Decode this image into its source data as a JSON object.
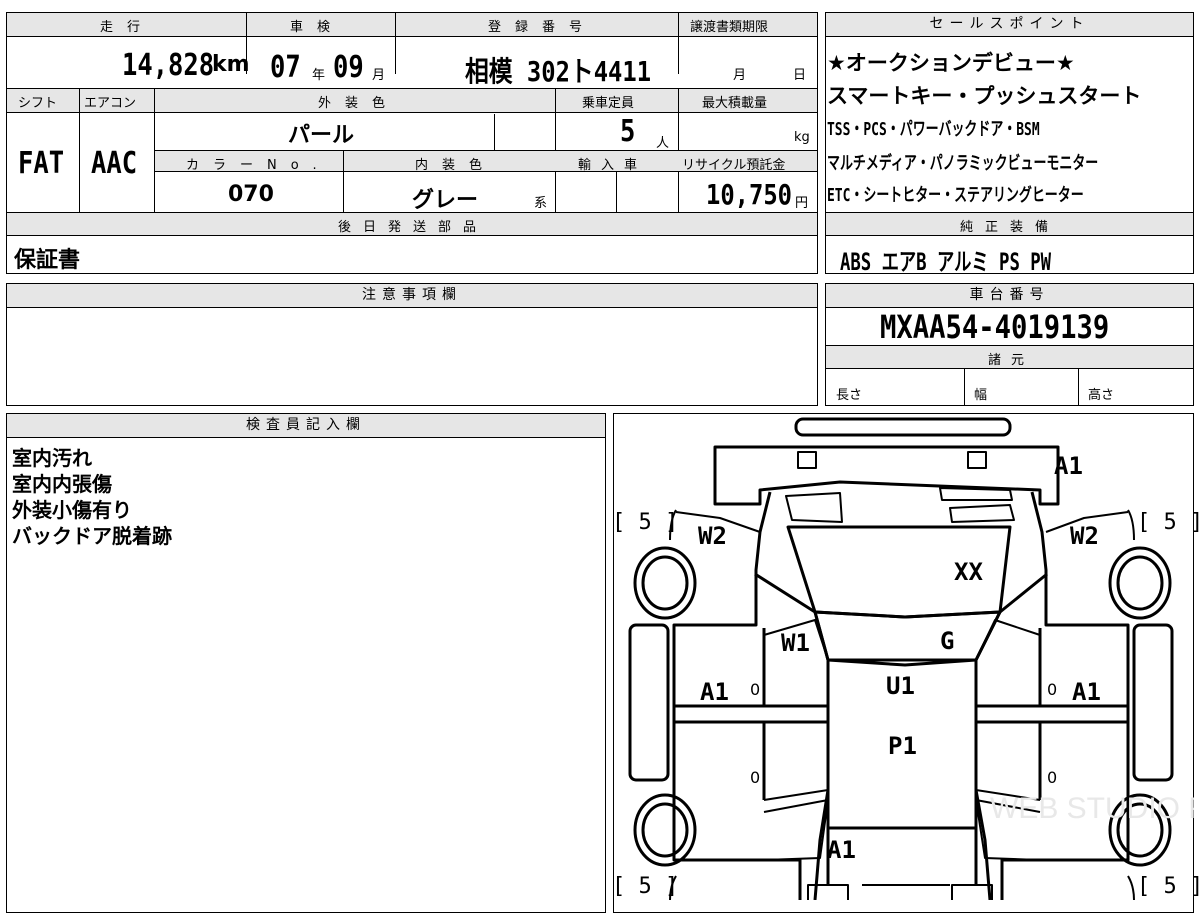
{
  "top_table": {
    "mileage_label": "走行",
    "mileage_value": "14,828",
    "mileage_unit": "km",
    "inspection_label": "車検",
    "inspection_year": "07",
    "inspection_year_unit": "年",
    "inspection_month": "09",
    "inspection_month_unit": "月",
    "plate_label": "登録番号",
    "plate_value": "相模 302ト4411",
    "transfer_label": "譲渡書類期限",
    "transfer_month_unit": "月",
    "transfer_day_unit": "日",
    "shift_label": "シフト",
    "shift_value": "FAT",
    "aircon_label": "エアコン",
    "aircon_value": "AAC",
    "exterior_color_label": "外装色",
    "exterior_color_value": "パール",
    "capacity_label": "乗車定員",
    "capacity_value": "5",
    "capacity_unit": "人",
    "max_load_label": "最大積載量",
    "max_load_unit": "kg",
    "color_no_label": "カラーNo.",
    "color_no_value": "070",
    "interior_color_label": "内装色",
    "interior_color_value": "グレー",
    "interior_color_suffix": "系",
    "import_label": "輸入車",
    "recycle_label": "リサイクル預託金",
    "recycle_value": "10,750",
    "recycle_unit": "円",
    "later_parts_label": "後日発送部品",
    "later_parts_value": "保証書"
  },
  "sales_points": {
    "header": "セールスポイント",
    "lines": [
      "★オークションデビュー★",
      "スマートキー・プッシュスタート",
      "TSS・PCS・パワーバックドア・BSM",
      "マルチメディア・パノラミックビューモニター",
      "ETC・シートヒター・ステアリングヒーター"
    ]
  },
  "genuine_equipment": {
    "header": "純正装備",
    "value": "ABS エアB アルミ PS PW"
  },
  "notes": {
    "header": "注意事項欄"
  },
  "chassis": {
    "header": "車台番号",
    "value": "MXAA54-4019139",
    "spec_header": "諸元",
    "length_label": "長さ",
    "width_label": "幅",
    "height_label": "高さ"
  },
  "inspector": {
    "header": "検査員記入欄",
    "lines": [
      "室内汚れ",
      "室内内張傷",
      "外装小傷有り",
      "バックドア脱着跡"
    ]
  },
  "diagram": {
    "tire_labels": [
      "[ 5 ]",
      "[ 5 ]",
      "[ 5 ]",
      "[ 5 ]"
    ],
    "marks": {
      "front_bumper": "A1",
      "windshield_left": "W2",
      "windshield_right": "W2",
      "hood": "XX",
      "front_window": "W1",
      "hood_rear": "G",
      "left_front_door": "A1",
      "right_front_door": "A1",
      "roof_front": "U1",
      "roof_rear": "P1",
      "rear_panel": "A1",
      "door_zero_1": "0",
      "door_zero_2": "0",
      "door_zero_3": "0",
      "door_zero_4": "0"
    },
    "watermark": "WEB STUDIO PRO"
  }
}
